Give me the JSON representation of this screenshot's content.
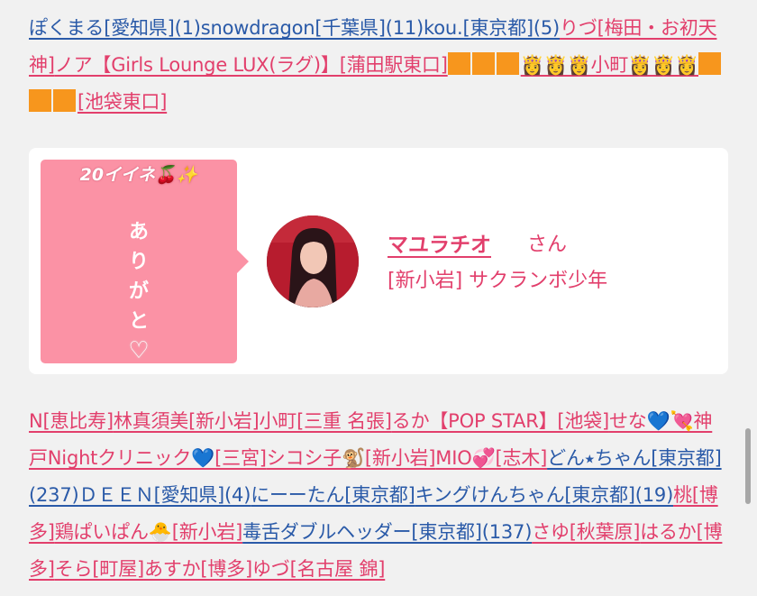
{
  "top_names": [
    {
      "text": "ぽくまる[愛知県](1)",
      "color": "blue"
    },
    {
      "text": "snowdragon[千葉県](11)",
      "color": "blue"
    },
    {
      "text": "kou.[東京都](5)",
      "color": "blue"
    },
    {
      "text": "りづ[梅田・お初天神]",
      "color": "pink"
    },
    {
      "text": "ノア【Girls Lounge LUX(ラグ)】[蒲田駅東口]",
      "color": "pink"
    },
    {
      "text": "👸👸👸小町👸👸👸",
      "color": "pink"
    },
    {
      "text": "[池袋東口]",
      "color": "pink"
    }
  ],
  "card": {
    "likes": "20イイネ🍒✨",
    "thanks_lines": [
      "あ",
      "り",
      "が",
      "と"
    ],
    "heart": "♡",
    "cast_name": "マユラチオ",
    "san": "さん",
    "shop": "[新小岩] サクランボ少年"
  },
  "bottom_names": [
    {
      "text": "N[恵比寿]",
      "color": "pink"
    },
    {
      "text": "林真須美[新小岩]",
      "color": "pink"
    },
    {
      "text": "小町[三重 名張]",
      "color": "pink"
    },
    {
      "text": "るか【POP STAR】[池袋]",
      "color": "pink"
    },
    {
      "text": "せな💙💘神戸Nightクリニック💙[三宮]",
      "color": "pink"
    },
    {
      "text": "シコシ子🐒[新小岩]",
      "color": "pink"
    },
    {
      "text": "MIO💞[志木]",
      "color": "pink"
    },
    {
      "text": "どん⭑ちゃん[東京都](237)",
      "color": "blue"
    },
    {
      "text": "ＤＥＥＮ[愛知県](4)",
      "color": "blue"
    },
    {
      "text": "にーーたん[東京都]",
      "color": "blue"
    },
    {
      "text": "キングけんちゃん[東京都](19)",
      "color": "blue"
    },
    {
      "text": "桃[博多]",
      "color": "pink"
    },
    {
      "text": "鶏ぱいぱん🐣[新小岩]",
      "color": "pink"
    },
    {
      "text": "毒舌ダブルヘッダー[東京都](137)",
      "color": "blue"
    },
    {
      "text": "さゆ[秋葉原]",
      "color": "pink"
    },
    {
      "text": "はるか[博多]",
      "color": "pink"
    },
    {
      "text": "そら[町屋]",
      "color": "pink"
    },
    {
      "text": "あすか[博多]",
      "color": "pink"
    },
    {
      "text": "ゆづ[名古屋 錦]",
      "color": "pink"
    }
  ],
  "colors": {
    "blue_link": "#2a5aa8",
    "pink_link": "#e23f6c",
    "card_pink": "#fb92a5",
    "background": "#f1f1f1"
  }
}
